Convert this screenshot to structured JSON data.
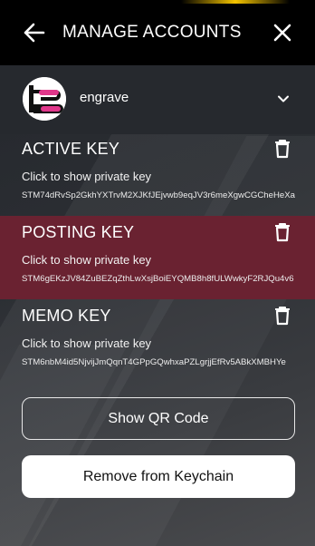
{
  "header": {
    "title": "MANAGE ACCOUNTS",
    "back_icon": "arrow-left-icon",
    "close_icon": "close-icon"
  },
  "account": {
    "name": "engrave",
    "avatar_icon": "engrave-logo",
    "dropdown_icon": "chevron-down-icon"
  },
  "keys": [
    {
      "title": "ACTIVE KEY",
      "hint": "Click to show private key",
      "public_key": "STM74dRvSp2GkhYXTrvM2XJKfJEjvwb9eqJV3r6meXgwCGCheHeXa"
    },
    {
      "title": "POSTING KEY",
      "hint": "Click to show private key",
      "public_key": "STM6gEKzJV84ZuBEZqZthLwXsjBoiEYQMB8h8fULWwkyF2RJQu4v6"
    },
    {
      "title": "MEMO KEY",
      "hint": "Click to show private key",
      "public_key": "STM6nbM4id5NjvijJmQqnT4GPpGQwhxaPZLgrjjEfRv5ABkXMBHYe"
    }
  ],
  "buttons": {
    "qr": "Show QR Code",
    "remove": "Remove from Keychain"
  },
  "colors": {
    "header_bg": "#000000",
    "posting_highlight": "#6a2231",
    "accent_yellow": "#f5c400",
    "logo_pink": "#e0368a"
  }
}
